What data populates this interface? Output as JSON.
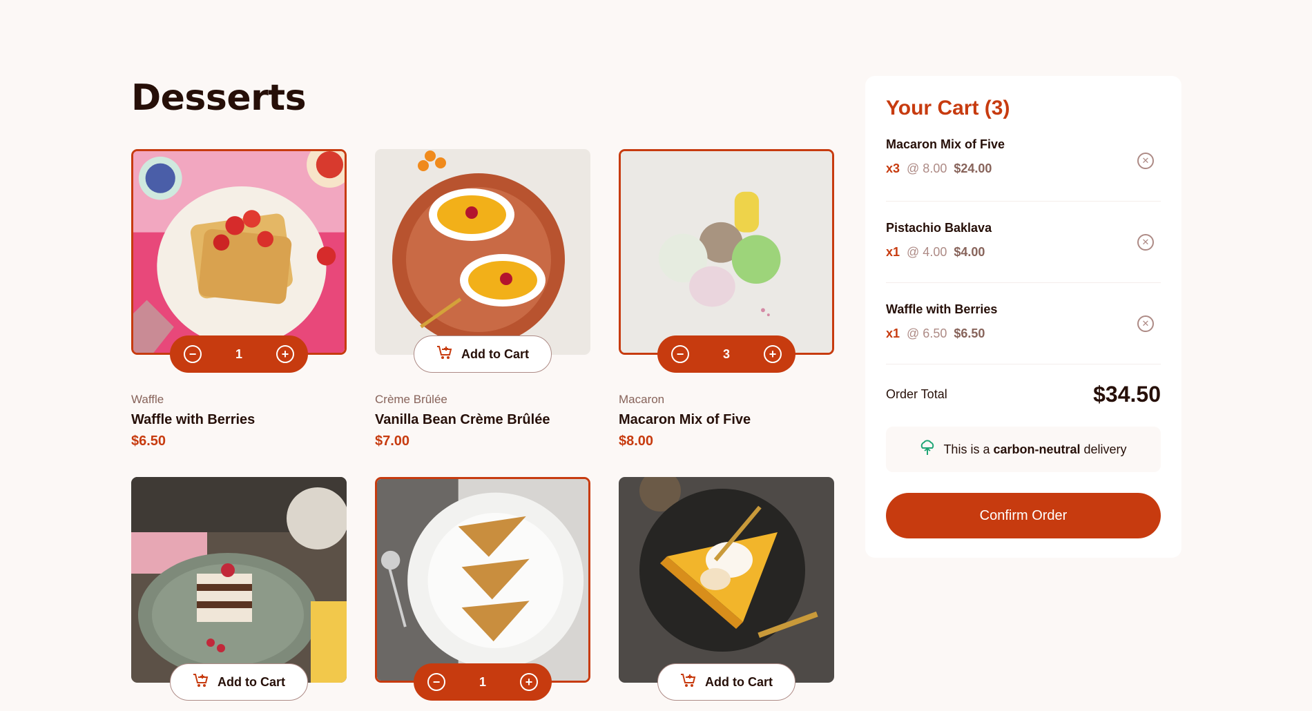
{
  "page": {
    "title": "Desserts"
  },
  "products": [
    {
      "category": "Waffle",
      "name": "Waffle with Berries",
      "price": "$6.50",
      "in_cart": true,
      "quantity": "1",
      "image": "waffle-image"
    },
    {
      "category": "Crème Brûlée",
      "name": "Vanilla Bean Crème Brûlée",
      "price": "$7.00",
      "in_cart": false,
      "image": "creme-brulee-image"
    },
    {
      "category": "Macaron",
      "name": "Macaron Mix of Five",
      "price": "$8.00",
      "in_cart": true,
      "quantity": "3",
      "image": "macaron-image"
    },
    {
      "category": "",
      "name": "",
      "price": "",
      "in_cart": false,
      "image": "tiramisu-image"
    },
    {
      "category": "",
      "name": "",
      "price": "",
      "in_cart": true,
      "quantity": "1",
      "image": "baklava-image"
    },
    {
      "category": "",
      "name": "",
      "price": "",
      "in_cart": false,
      "image": "pie-image"
    }
  ],
  "buttons": {
    "add_to_cart": "Add to Cart"
  },
  "cart": {
    "title": "Your Cart (3)",
    "items": [
      {
        "name": "Macaron Mix of Five",
        "qty": "x3",
        "unit": "@ 8.00",
        "total": "$24.00"
      },
      {
        "name": "Pistachio Baklava",
        "qty": "x1",
        "unit": "@ 4.00",
        "total": "$4.00"
      },
      {
        "name": "Waffle with Berries",
        "qty": "x1",
        "unit": "@ 6.50",
        "total": "$6.50"
      }
    ],
    "order_total_label": "Order Total",
    "order_total_value": "$34.50",
    "carbon_prefix": "This is a",
    "carbon_bold": "carbon-neutral",
    "carbon_suffix": "delivery",
    "confirm_label": "Confirm Order"
  },
  "colors": {
    "accent": "#c73b0f",
    "background": "#fcf8f6",
    "text": "#260f08"
  }
}
